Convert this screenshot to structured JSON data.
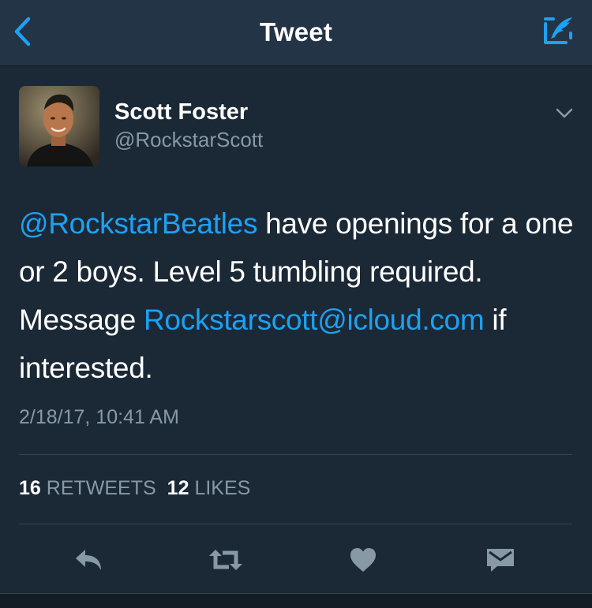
{
  "navbar": {
    "title": "Tweet",
    "back_icon": "chevron-left-icon",
    "compose_icon": "compose-tweet-icon",
    "accent_color": "#1da1f2"
  },
  "tweet": {
    "author": {
      "name": "Scott Foster",
      "handle": "@RockstarScott"
    },
    "text": {
      "mention": "@RockstarBeatles",
      "part1": " have openings for a one or 2 boys. Level 5 tumbling required. Message ",
      "email": "Rockstarscott@icloud.com",
      "part2": " if interested."
    },
    "timestamp": "2/18/17, 10:41 AM",
    "stats": {
      "retweets_count": "16",
      "retweets_label": "RETWEETS",
      "likes_count": "12",
      "likes_label": "LIKES"
    }
  },
  "actions": [
    {
      "icon": "reply-icon"
    },
    {
      "icon": "retweet-icon"
    },
    {
      "icon": "heart-icon"
    },
    {
      "icon": "direct-message-icon"
    }
  ],
  "colors": {
    "background": "#1b2836",
    "navbar": "#243447",
    "secondary_text": "#8899a6",
    "link": "#1da1f2",
    "divider": "#38444d"
  }
}
